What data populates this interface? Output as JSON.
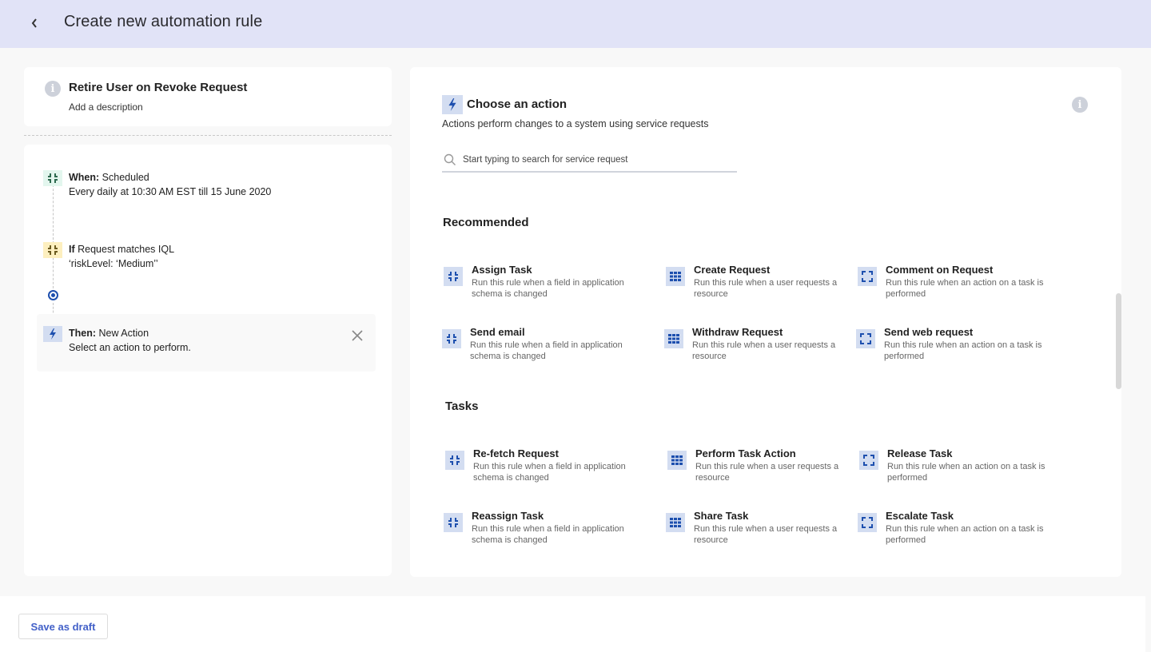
{
  "header": {
    "title": "Create new automation rule",
    "back_icon": "chevron-left-icon"
  },
  "rule": {
    "title": "Retire User on Revoke Request",
    "description_placeholder": "Add a description",
    "info_icon": "info-icon"
  },
  "flow": {
    "when": {
      "label": "When:",
      "value": "Scheduled",
      "detail": "Every daily at 10:30 AM EST till 15 June 2020",
      "icon": "compress-icon",
      "icon_bg": "#e3f6ee",
      "icon_color": "#2d6a4f"
    },
    "if": {
      "label": "If",
      "value": "Request matches IQL",
      "detail": "‘riskLevel: ‘Medium’’",
      "icon": "compress-icon",
      "icon_bg": "#fdefbf",
      "icon_color": "#6b5a1e"
    },
    "then": {
      "label": "Then:",
      "value": "New Action",
      "detail": "Select an action to perform.",
      "icon": "lightning-icon"
    }
  },
  "panel": {
    "title": "Choose an action",
    "subtitle": "Actions perform changes to a system using service requests",
    "search_placeholder": "Start typing to search for service request",
    "search_value": ""
  },
  "sections": [
    {
      "title": "Recommended",
      "items": [
        {
          "name": "Assign Task",
          "desc": "Run this rule when a field in application schema is changed",
          "icon": "compress"
        },
        {
          "name": "Create Request",
          "desc": "Run this rule when a user requests a resource",
          "icon": "grid"
        },
        {
          "name": "Comment on Request",
          "desc": "Run this rule when an action on a task is performed",
          "icon": "expand"
        },
        {
          "name": "Send email",
          "desc": "Run this rule when a field in application schema is changed",
          "icon": "compress"
        },
        {
          "name": "Withdraw Request",
          "desc": "Run this rule when a user requests a resource",
          "icon": "grid"
        },
        {
          "name": "Send web request",
          "desc": "Run this rule when an action on a task is performed",
          "icon": "expand"
        }
      ]
    },
    {
      "title": "Tasks",
      "items": [
        {
          "name": "Re-fetch Request",
          "desc": "Run this rule when a field in application schema is changed",
          "icon": "compress"
        },
        {
          "name": "Perform Task Action",
          "desc": "Run this rule when a user requests a resource",
          "icon": "grid"
        },
        {
          "name": "Release Task",
          "desc": "Run this rule when an action on a task is performed",
          "icon": "expand"
        },
        {
          "name": "Reassign Task",
          "desc": "Run this rule when a field in application schema is changed",
          "icon": "compress"
        },
        {
          "name": "Share Task",
          "desc": "Run this rule when a user requests a resource",
          "icon": "grid"
        },
        {
          "name": "Escalate Task",
          "desc": "Run this rule when an action on a task is performed",
          "icon": "expand"
        }
      ]
    }
  ],
  "footer": {
    "save_draft_label": "Save as draft"
  },
  "colors": {
    "header_bg": "#e1e3f7",
    "accent": "#1d4fae",
    "icon_bg": "#d3ddf1",
    "link": "#4260c8"
  }
}
